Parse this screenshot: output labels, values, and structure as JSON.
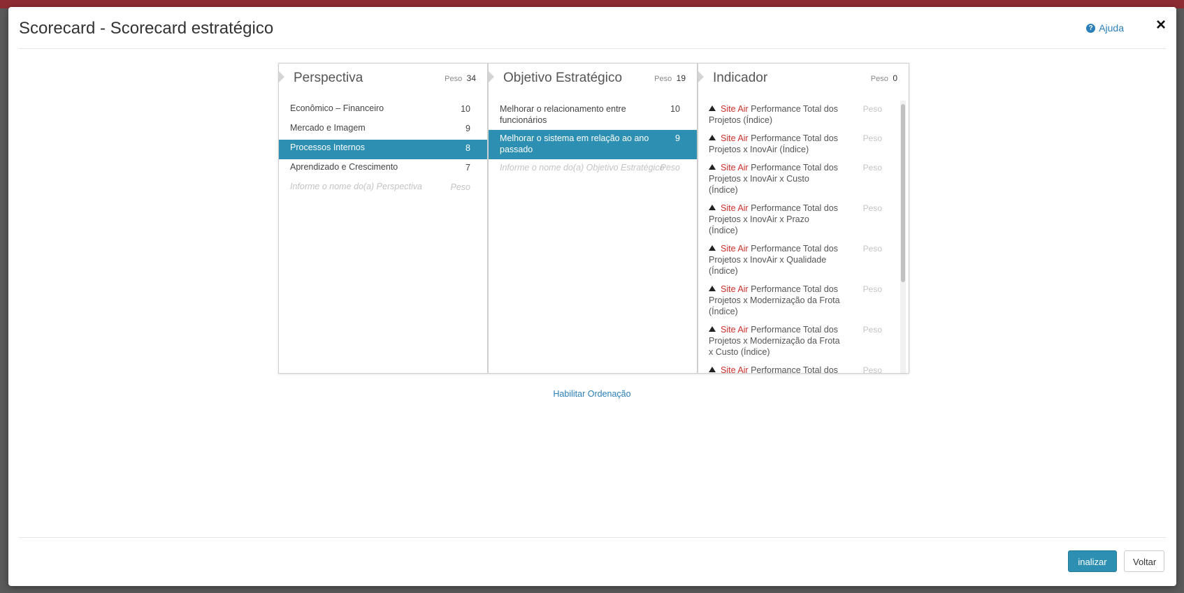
{
  "modal": {
    "title": "Scorecard - Scorecard estratégico",
    "help_label": "Ajuda",
    "close_glyph": "×"
  },
  "columns": {
    "perspectiva": {
      "title": "Perspectiva",
      "weight_label": "Peso",
      "weight_value": "34",
      "items": [
        {
          "label": "Econômico – Financeiro",
          "weight": "10",
          "selected": false
        },
        {
          "label": "Mercado e Imagem",
          "weight": "9",
          "selected": false
        },
        {
          "label": "Processos Internos",
          "weight": "8",
          "selected": true
        },
        {
          "label": "Aprendizado e Crescimento",
          "weight": "7",
          "selected": false
        }
      ],
      "new_placeholder": "Informe o nome do(a) Perspectiva",
      "new_weight_placeholder": "Peso"
    },
    "objetivo": {
      "title": "Objetivo Estratégico",
      "weight_label": "Peso",
      "weight_value": "19",
      "items": [
        {
          "label": "Melhorar o relacionamento entre funcionários",
          "weight": "10",
          "selected": false
        },
        {
          "label": "Melhorar o sistema em relação ao ano passado",
          "weight": "9",
          "selected": true
        }
      ],
      "new_placeholder": "Informe o nome do(a) Objetivo Estratégico",
      "new_weight_placeholder": "Peso"
    },
    "indicador": {
      "title": "Indicador",
      "weight_label": "Peso",
      "weight_value": "0",
      "site_label": "Site Air",
      "items": [
        {
          "text": "Performance Total dos Projetos (Índice)",
          "weight_placeholder": "Peso"
        },
        {
          "text": "Performance Total dos Projetos x InovAir (Índice)",
          "weight_placeholder": "Peso"
        },
        {
          "text": "Performance Total dos Projetos x InovAir x Custo (Índice)",
          "weight_placeholder": "Peso"
        },
        {
          "text": "Performance Total dos Projetos x InovAir x Prazo (Índice)",
          "weight_placeholder": "Peso"
        },
        {
          "text": "Performance Total dos Projetos x InovAir x Qualidade (Índice)",
          "weight_placeholder": "Peso"
        },
        {
          "text": "Performance Total dos Projetos x Modernização da Frota (Índice)",
          "weight_placeholder": "Peso"
        },
        {
          "text": "Performance Total dos Projetos x Modernização da Frota x Custo (Índice)",
          "weight_placeholder": "Peso"
        },
        {
          "text": "Performance Total dos Projetos x Modernização da Frota x Prazo (Índice)",
          "weight_placeholder": "Peso"
        }
      ]
    }
  },
  "enable_sort_label": "Habilitar Ordenação",
  "footer": {
    "finalize_label": "inalizar",
    "back_label": "Voltar"
  },
  "colors": {
    "selected": "#2d8fb2",
    "link": "#2a7fb8",
    "site": "#c9302c"
  }
}
